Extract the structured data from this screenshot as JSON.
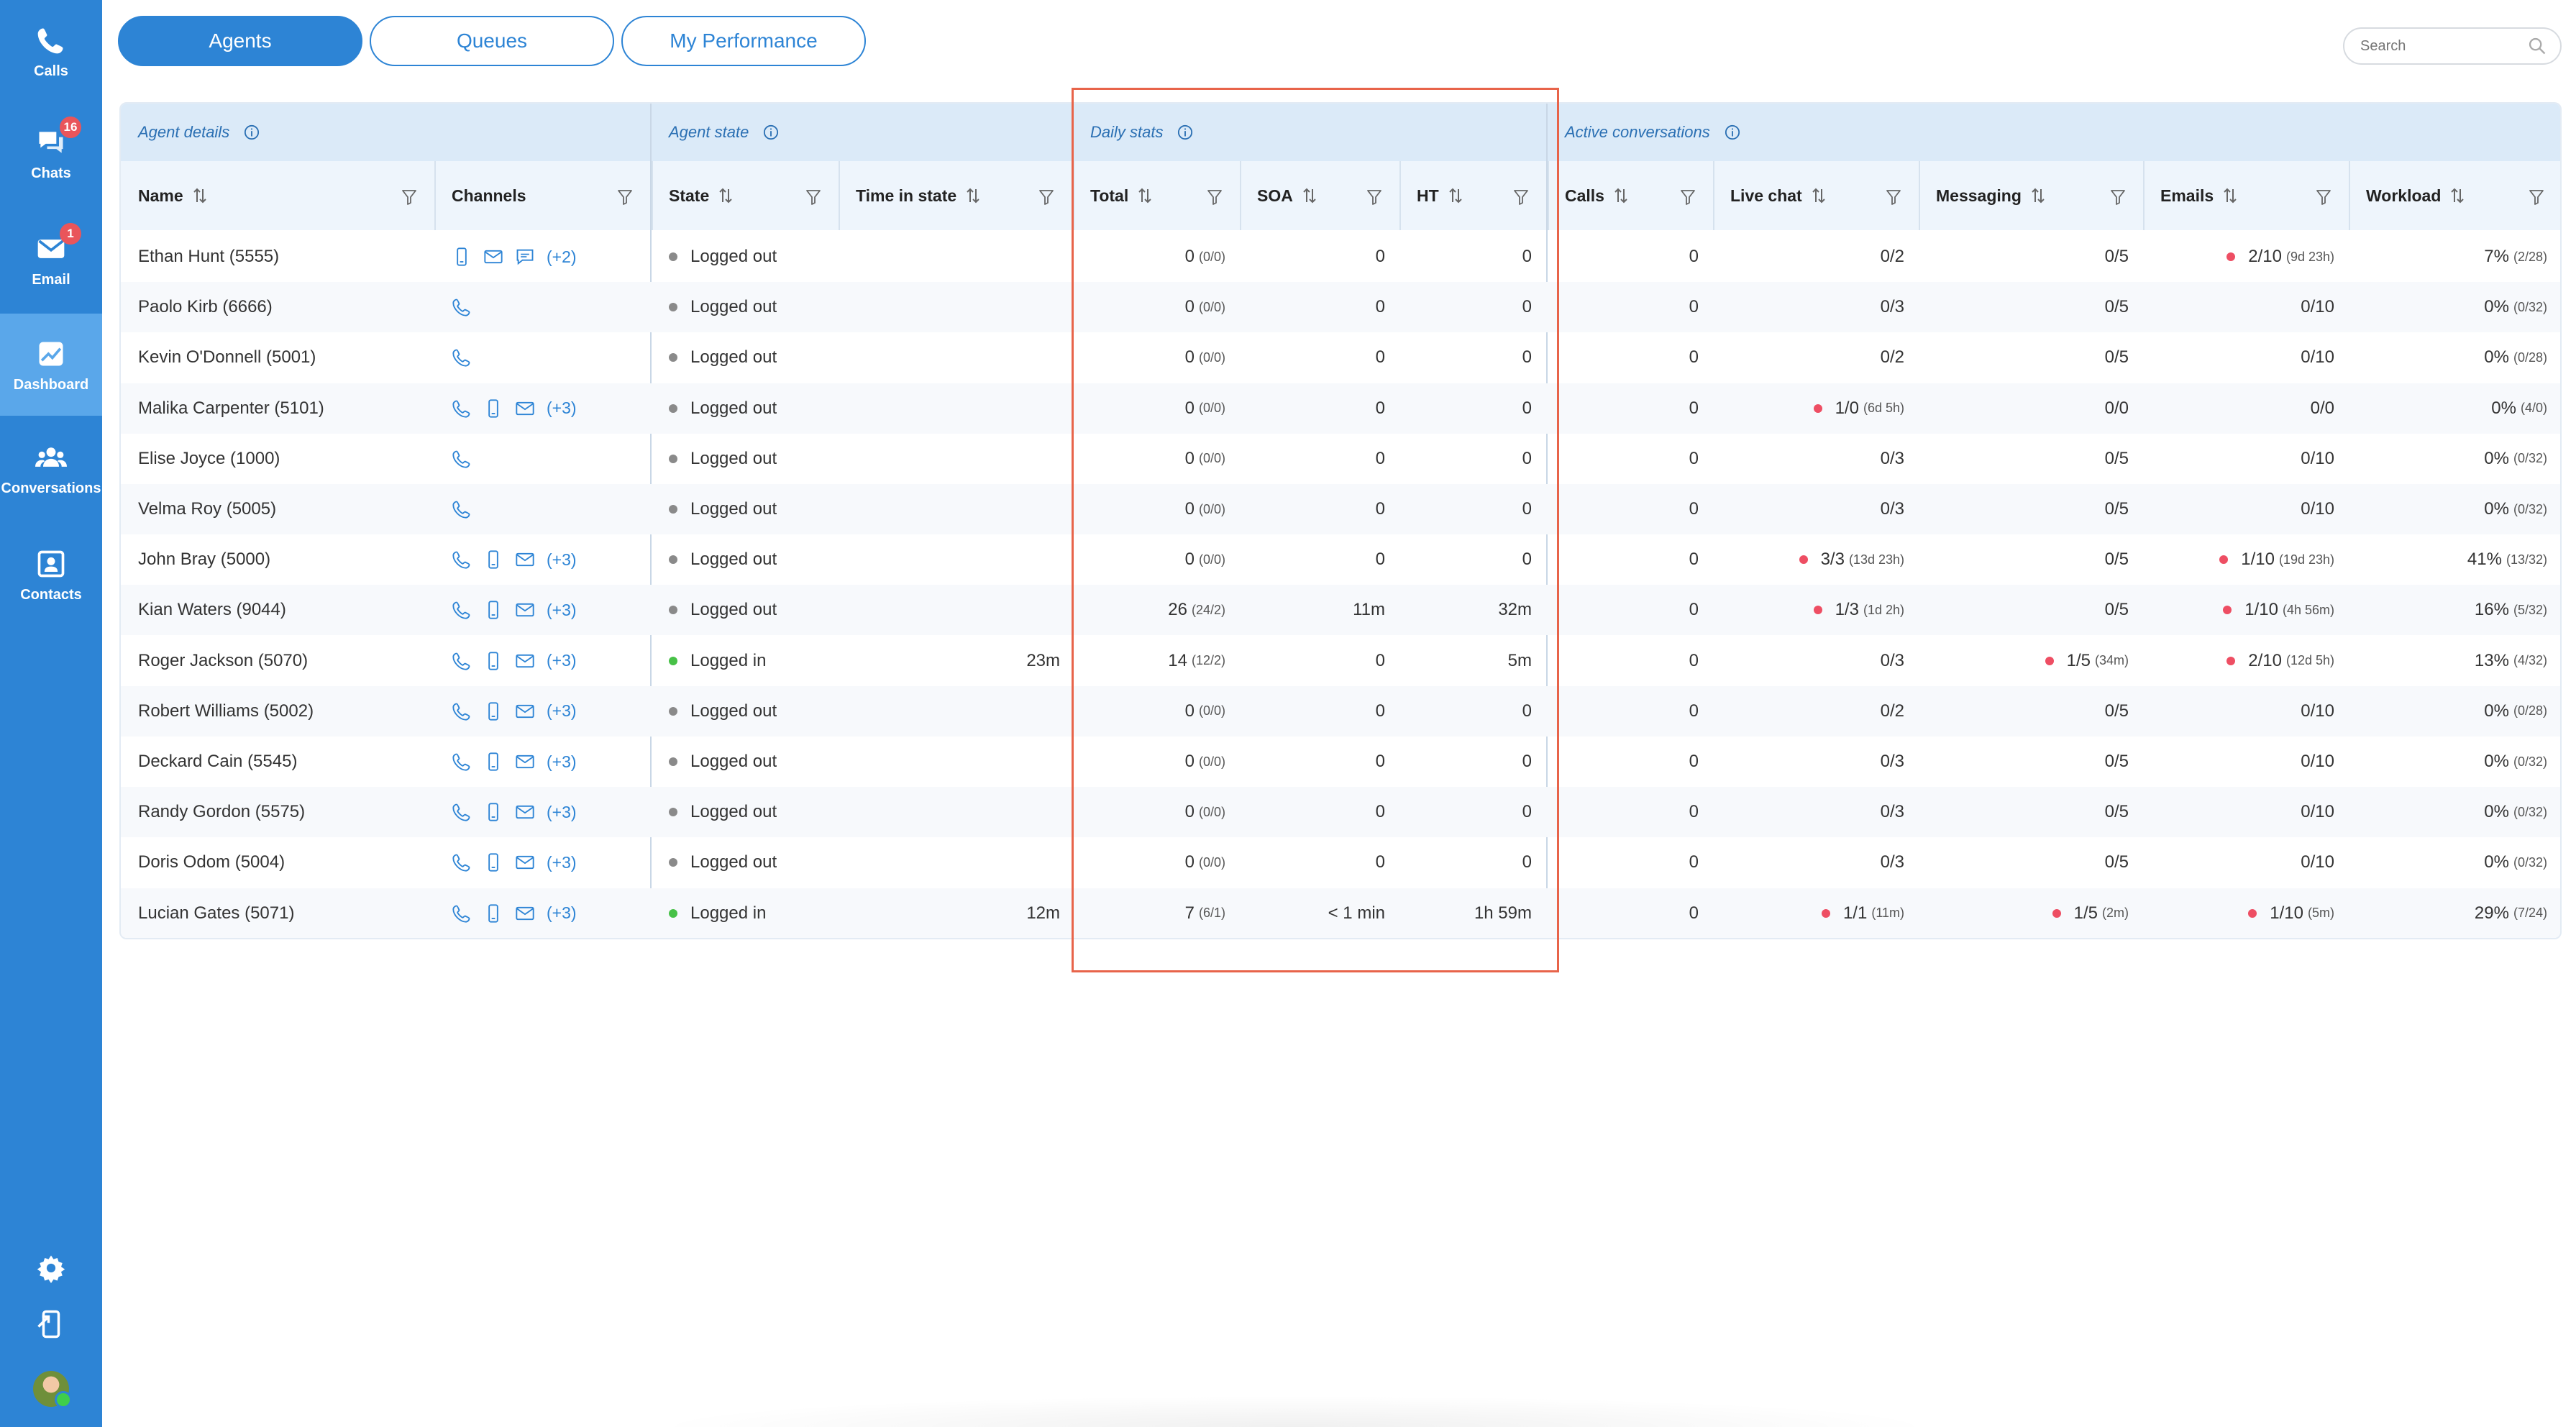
{
  "sidebar": {
    "items": [
      {
        "label": "Calls",
        "icon": "phone-icon"
      },
      {
        "label": "Chats",
        "icon": "chat-icon",
        "badge": "16"
      },
      {
        "label": "Email",
        "icon": "email-icon",
        "badge": "1"
      },
      {
        "label": "Dashboard",
        "icon": "dashboard-icon",
        "active": true
      },
      {
        "label": "Conversations",
        "icon": "group-icon"
      },
      {
        "label": "Contacts",
        "icon": "contact-card-icon"
      }
    ],
    "bottom_icons": [
      "gear-icon",
      "phone-transfer-icon",
      "user-avatar"
    ]
  },
  "tabs": [
    {
      "label": "Agents",
      "active": true
    },
    {
      "label": "Queues",
      "active": false
    },
    {
      "label": "My Performance",
      "active": false
    }
  ],
  "search": {
    "placeholder": "Search"
  },
  "groups": {
    "agent_details": "Agent details",
    "agent_state": "Agent state",
    "daily_stats": "Daily stats",
    "active_conversations": "Active conversations"
  },
  "columns": {
    "name": "Name",
    "channels": "Channels",
    "state": "State",
    "time_in_state": "Time in state",
    "total": "Total",
    "soa": "SOA",
    "ht": "HT",
    "calls": "Calls",
    "live_chat": "Live chat",
    "messaging": "Messaging",
    "emails": "Emails",
    "workload": "Workload"
  },
  "rows": [
    {
      "name": "Ethan Hunt (5555)",
      "channels": [
        "mobile",
        "email",
        "chat"
      ],
      "more": "(+2)",
      "state": "Logged out",
      "state_on": false,
      "time": "",
      "total": "0",
      "total_sub": "(0/0)",
      "soa": "0",
      "ht": "0",
      "calls": "0",
      "live": "0/2",
      "live_sub": "",
      "live_dot": false,
      "msg": "0/5",
      "msg_sub": "",
      "msg_dot": false,
      "email": "2/10",
      "email_sub": "(9d 23h)",
      "email_dot": true,
      "work": "7%",
      "work_sub": "(2/28)"
    },
    {
      "name": "Paolo Kirb (6666)",
      "channels": [
        "phone"
      ],
      "more": "",
      "state": "Logged out",
      "state_on": false,
      "time": "",
      "total": "0",
      "total_sub": "(0/0)",
      "soa": "0",
      "ht": "0",
      "calls": "0",
      "live": "0/3",
      "live_sub": "",
      "live_dot": false,
      "msg": "0/5",
      "msg_sub": "",
      "msg_dot": false,
      "email": "0/10",
      "email_sub": "",
      "email_dot": false,
      "work": "0%",
      "work_sub": "(0/32)"
    },
    {
      "name": "Kevin O'Donnell (5001)",
      "channels": [
        "phone"
      ],
      "more": "",
      "state": "Logged out",
      "state_on": false,
      "time": "",
      "total": "0",
      "total_sub": "(0/0)",
      "soa": "0",
      "ht": "0",
      "calls": "0",
      "live": "0/2",
      "live_sub": "",
      "live_dot": false,
      "msg": "0/5",
      "msg_sub": "",
      "msg_dot": false,
      "email": "0/10",
      "email_sub": "",
      "email_dot": false,
      "work": "0%",
      "work_sub": "(0/28)"
    },
    {
      "name": "Malika Carpenter (5101)",
      "channels": [
        "phone",
        "mobile",
        "email"
      ],
      "more": "(+3)",
      "state": "Logged out",
      "state_on": false,
      "time": "",
      "total": "0",
      "total_sub": "(0/0)",
      "soa": "0",
      "ht": "0",
      "calls": "0",
      "live": "1/0",
      "live_sub": "(6d 5h)",
      "live_dot": true,
      "msg": "0/0",
      "msg_sub": "",
      "msg_dot": false,
      "email": "0/0",
      "email_sub": "",
      "email_dot": false,
      "work": "0%",
      "work_sub": "(4/0)"
    },
    {
      "name": "Elise Joyce (1000)",
      "channels": [
        "phone"
      ],
      "more": "",
      "state": "Logged out",
      "state_on": false,
      "time": "",
      "total": "0",
      "total_sub": "(0/0)",
      "soa": "0",
      "ht": "0",
      "calls": "0",
      "live": "0/3",
      "live_sub": "",
      "live_dot": false,
      "msg": "0/5",
      "msg_sub": "",
      "msg_dot": false,
      "email": "0/10",
      "email_sub": "",
      "email_dot": false,
      "work": "0%",
      "work_sub": "(0/32)"
    },
    {
      "name": "Velma Roy (5005)",
      "channels": [
        "phone"
      ],
      "more": "",
      "state": "Logged out",
      "state_on": false,
      "time": "",
      "total": "0",
      "total_sub": "(0/0)",
      "soa": "0",
      "ht": "0",
      "calls": "0",
      "live": "0/3",
      "live_sub": "",
      "live_dot": false,
      "msg": "0/5",
      "msg_sub": "",
      "msg_dot": false,
      "email": "0/10",
      "email_sub": "",
      "email_dot": false,
      "work": "0%",
      "work_sub": "(0/32)"
    },
    {
      "name": "John Bray (5000)",
      "channels": [
        "phone",
        "mobile",
        "email"
      ],
      "more": "(+3)",
      "state": "Logged out",
      "state_on": false,
      "time": "",
      "total": "0",
      "total_sub": "(0/0)",
      "soa": "0",
      "ht": "0",
      "calls": "0",
      "live": "3/3",
      "live_sub": "(13d 23h)",
      "live_dot": true,
      "msg": "0/5",
      "msg_sub": "",
      "msg_dot": false,
      "email": "1/10",
      "email_sub": "(19d 23h)",
      "email_dot": true,
      "work": "41%",
      "work_sub": "(13/32)"
    },
    {
      "name": "Kian Waters (9044)",
      "channels": [
        "phone",
        "mobile",
        "email"
      ],
      "more": "(+3)",
      "state": "Logged out",
      "state_on": false,
      "time": "",
      "total": "26",
      "total_sub": "(24/2)",
      "soa": "11m",
      "ht": "32m",
      "calls": "0",
      "live": "1/3",
      "live_sub": "(1d 2h)",
      "live_dot": true,
      "msg": "0/5",
      "msg_sub": "",
      "msg_dot": false,
      "email": "1/10",
      "email_sub": "(4h 56m)",
      "email_dot": true,
      "work": "16%",
      "work_sub": "(5/32)"
    },
    {
      "name": "Roger Jackson (5070)",
      "channels": [
        "phone",
        "mobile",
        "email"
      ],
      "more": "(+3)",
      "state": "Logged in",
      "state_on": true,
      "time": "23m",
      "total": "14",
      "total_sub": "(12/2)",
      "soa": "0",
      "ht": "5m",
      "calls": "0",
      "live": "0/3",
      "live_sub": "",
      "live_dot": false,
      "msg": "1/5",
      "msg_sub": "(34m)",
      "msg_dot": true,
      "email": "2/10",
      "email_sub": "(12d 5h)",
      "email_dot": true,
      "work": "13%",
      "work_sub": "(4/32)"
    },
    {
      "name": "Robert Williams (5002)",
      "channels": [
        "phone",
        "mobile",
        "email"
      ],
      "more": "(+3)",
      "state": "Logged out",
      "state_on": false,
      "time": "",
      "total": "0",
      "total_sub": "(0/0)",
      "soa": "0",
      "ht": "0",
      "calls": "0",
      "live": "0/2",
      "live_sub": "",
      "live_dot": false,
      "msg": "0/5",
      "msg_sub": "",
      "msg_dot": false,
      "email": "0/10",
      "email_sub": "",
      "email_dot": false,
      "work": "0%",
      "work_sub": "(0/28)"
    },
    {
      "name": "Deckard Cain (5545)",
      "channels": [
        "phone",
        "mobile",
        "email"
      ],
      "more": "(+3)",
      "state": "Logged out",
      "state_on": false,
      "time": "",
      "total": "0",
      "total_sub": "(0/0)",
      "soa": "0",
      "ht": "0",
      "calls": "0",
      "live": "0/3",
      "live_sub": "",
      "live_dot": false,
      "msg": "0/5",
      "msg_sub": "",
      "msg_dot": false,
      "email": "0/10",
      "email_sub": "",
      "email_dot": false,
      "work": "0%",
      "work_sub": "(0/32)"
    },
    {
      "name": "Randy Gordon (5575)",
      "channels": [
        "phone",
        "mobile",
        "email"
      ],
      "more": "(+3)",
      "state": "Logged out",
      "state_on": false,
      "time": "",
      "total": "0",
      "total_sub": "(0/0)",
      "soa": "0",
      "ht": "0",
      "calls": "0",
      "live": "0/3",
      "live_sub": "",
      "live_dot": false,
      "msg": "0/5",
      "msg_sub": "",
      "msg_dot": false,
      "email": "0/10",
      "email_sub": "",
      "email_dot": false,
      "work": "0%",
      "work_sub": "(0/32)"
    },
    {
      "name": "Doris Odom (5004)",
      "channels": [
        "phone",
        "mobile",
        "email"
      ],
      "more": "(+3)",
      "state": "Logged out",
      "state_on": false,
      "time": "",
      "total": "0",
      "total_sub": "(0/0)",
      "soa": "0",
      "ht": "0",
      "calls": "0",
      "live": "0/3",
      "live_sub": "",
      "live_dot": false,
      "msg": "0/5",
      "msg_sub": "",
      "msg_dot": false,
      "email": "0/10",
      "email_sub": "",
      "email_dot": false,
      "work": "0%",
      "work_sub": "(0/32)"
    },
    {
      "name": "Lucian Gates (5071)",
      "channels": [
        "phone",
        "mobile",
        "email"
      ],
      "more": "(+3)",
      "state": "Logged in",
      "state_on": true,
      "time": "12m",
      "total": "7",
      "total_sub": "(6/1)",
      "soa": "< 1 min",
      "ht": "1h 59m",
      "calls": "0",
      "live": "1/1",
      "live_sub": "(11m)",
      "live_dot": true,
      "msg": "1/5",
      "msg_sub": "(2m)",
      "msg_dot": true,
      "email": "1/10",
      "email_sub": "(5m)",
      "email_dot": true,
      "work": "29%",
      "work_sub": "(7/24)"
    }
  ],
  "colors": {
    "primary": "#2d84d5",
    "header_bg": "#dbeaf8",
    "logged_in": "#47c147",
    "logged_out": "#8a8a8a",
    "alert_dot": "#ee4e63",
    "highlight": "#e8644a"
  }
}
